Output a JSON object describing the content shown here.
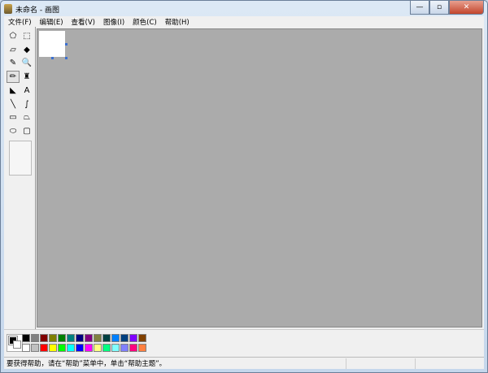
{
  "window": {
    "title": "未命名 - 画图",
    "min": "—",
    "max": "▫",
    "close": "✕"
  },
  "menu": [
    "文件(F)",
    "编辑(E)",
    "查看(V)",
    "图像(I)",
    "颜色(C)",
    "帮助(H)"
  ],
  "tools": [
    {
      "name": "free-select-icon",
      "g": "⬠"
    },
    {
      "name": "rect-select-icon",
      "g": "⬚"
    },
    {
      "name": "eraser-icon",
      "g": "▱"
    },
    {
      "name": "fill-icon",
      "g": "◆"
    },
    {
      "name": "color-picker-icon",
      "g": "✎"
    },
    {
      "name": "magnifier-icon",
      "g": "🔍"
    },
    {
      "name": "pencil-icon",
      "g": "✏",
      "sel": true
    },
    {
      "name": "brush-icon",
      "g": "♜"
    },
    {
      "name": "airbrush-icon",
      "g": "◣"
    },
    {
      "name": "text-icon",
      "g": "A"
    },
    {
      "name": "line-icon",
      "g": "╲"
    },
    {
      "name": "curve-icon",
      "g": "∫"
    },
    {
      "name": "rectangle-icon",
      "g": "▭"
    },
    {
      "name": "polygon-icon",
      "g": "⏢"
    },
    {
      "name": "ellipse-icon",
      "g": "⬭"
    },
    {
      "name": "rounded-rect-icon",
      "g": "▢"
    }
  ],
  "colors": {
    "foreground": "#000000",
    "background": "#ffffff"
  },
  "palette": {
    "top": [
      "#000000",
      "#808080",
      "#800000",
      "#808000",
      "#008000",
      "#008080",
      "#000080",
      "#800080",
      "#808040",
      "#004040",
      "#0080ff",
      "#004080",
      "#8000ff",
      "#804000"
    ],
    "bottom": [
      "#ffffff",
      "#c0c0c0",
      "#ff0000",
      "#ffff00",
      "#00ff00",
      "#00ffff",
      "#0000ff",
      "#ff00ff",
      "#ffff80",
      "#00ff80",
      "#80ffff",
      "#8080ff",
      "#ff0080",
      "#ff8040"
    ]
  },
  "status": "要获得帮助，请在“帮助”菜单中，单击“帮助主题”。"
}
